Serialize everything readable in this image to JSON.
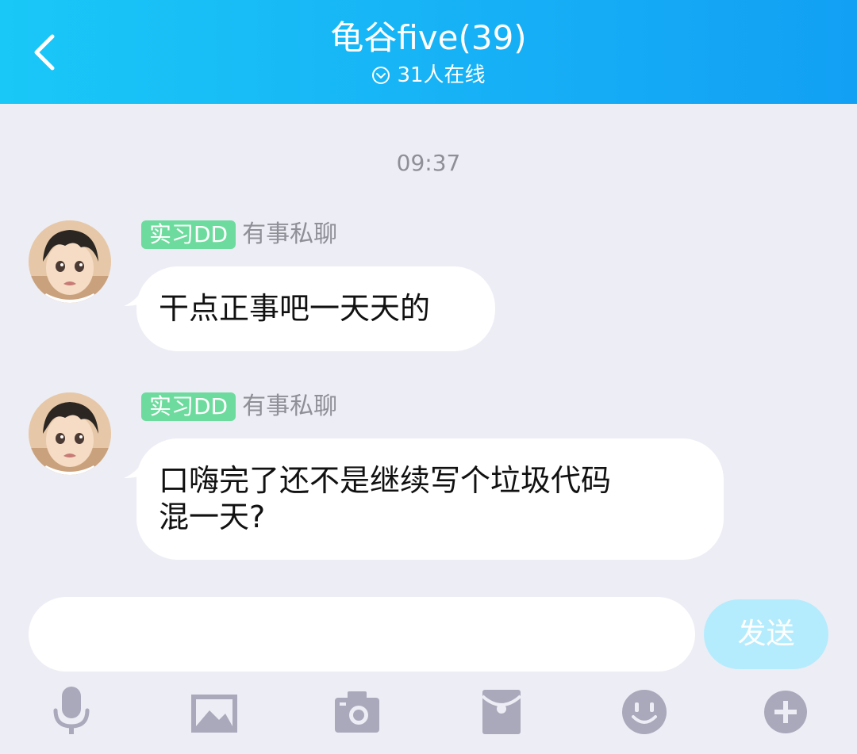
{
  "header": {
    "title": "龟谷five(39)",
    "online_status": "31人在线",
    "back_icon": "chevron-left-icon",
    "status_icon": "chevron-down-circle-icon"
  },
  "chat": {
    "timestamp": "09:37",
    "messages": [
      {
        "badge": "实习DD",
        "sender": "有事私聊",
        "text": "干点正事吧一天天的"
      },
      {
        "badge": "实习DD",
        "sender": "有事私聊",
        "text_line1": "口嗨完了还不是继续写个垃圾代码",
        "text_line2": "混一天?"
      }
    ]
  },
  "composer": {
    "input_value": "",
    "send_label": "发送"
  },
  "toolbar": {
    "items": [
      "microphone-icon",
      "image-icon",
      "camera-icon",
      "red-packet-icon",
      "emoji-icon",
      "plus-icon"
    ]
  },
  "colors": {
    "header_gradient_start": "#19c8f7",
    "header_gradient_end": "#12a0f4",
    "background": "#ededf5",
    "badge": "#6ddb9d",
    "send_button": "#b5ecfd",
    "icon_gray": "#a9a9bb"
  }
}
